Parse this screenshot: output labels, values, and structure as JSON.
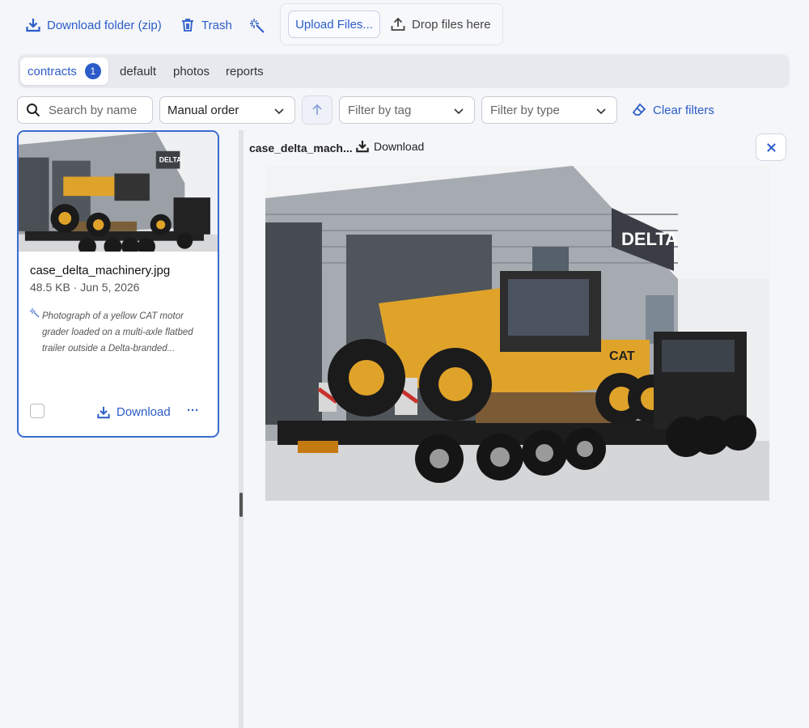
{
  "toolbar": {
    "download_folder_label": "Download folder (zip)",
    "trash_label": "Trash",
    "upload_label": "Upload Files...",
    "drop_label": "Drop files here"
  },
  "tabs": [
    {
      "label": "contracts",
      "count": "1",
      "active": true
    },
    {
      "label": "default"
    },
    {
      "label": "photos"
    },
    {
      "label": "reports"
    }
  ],
  "filters": {
    "search_placeholder": "Search by name",
    "sort_value": "Manual order",
    "tag_placeholder": "Filter by tag",
    "type_placeholder": "Filter by type",
    "clear_label": "Clear filters"
  },
  "file_card": {
    "name": "case_delta_machinery.jpg",
    "meta": "48.5 KB · Jun 5, 2026",
    "ai_caption": "Photograph of a yellow CAT motor grader loaded on a multi-axle flatbed trailer outside a Delta-branded...",
    "download_label": "Download",
    "more_label": "···"
  },
  "preview": {
    "filename": "case_delta_mach...",
    "download_label": "Download",
    "image_sign": "DELTA",
    "machine_brand": "CAT"
  },
  "colors": {
    "accent": "#2b5cc8",
    "background": "#f4f6f9",
    "grader_yellow": "#e0a32a"
  }
}
